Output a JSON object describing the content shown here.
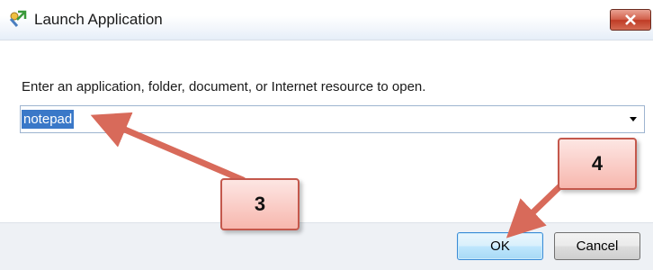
{
  "window": {
    "title": "Launch Application",
    "icon": "launch-app-icon",
    "close_icon": "close-icon"
  },
  "form": {
    "prompt": "Enter an application, folder, document, or Internet resource to open.",
    "input_value": "notepad"
  },
  "buttons": {
    "ok_label": "OK",
    "cancel_label": "Cancel"
  },
  "annotations": {
    "step3": "3",
    "step4": "4"
  },
  "colors": {
    "selection": "#3a78c8",
    "callout_border": "#c4584c",
    "callout_fill": "#f7b7ae",
    "arrow": "#d86a5a"
  }
}
